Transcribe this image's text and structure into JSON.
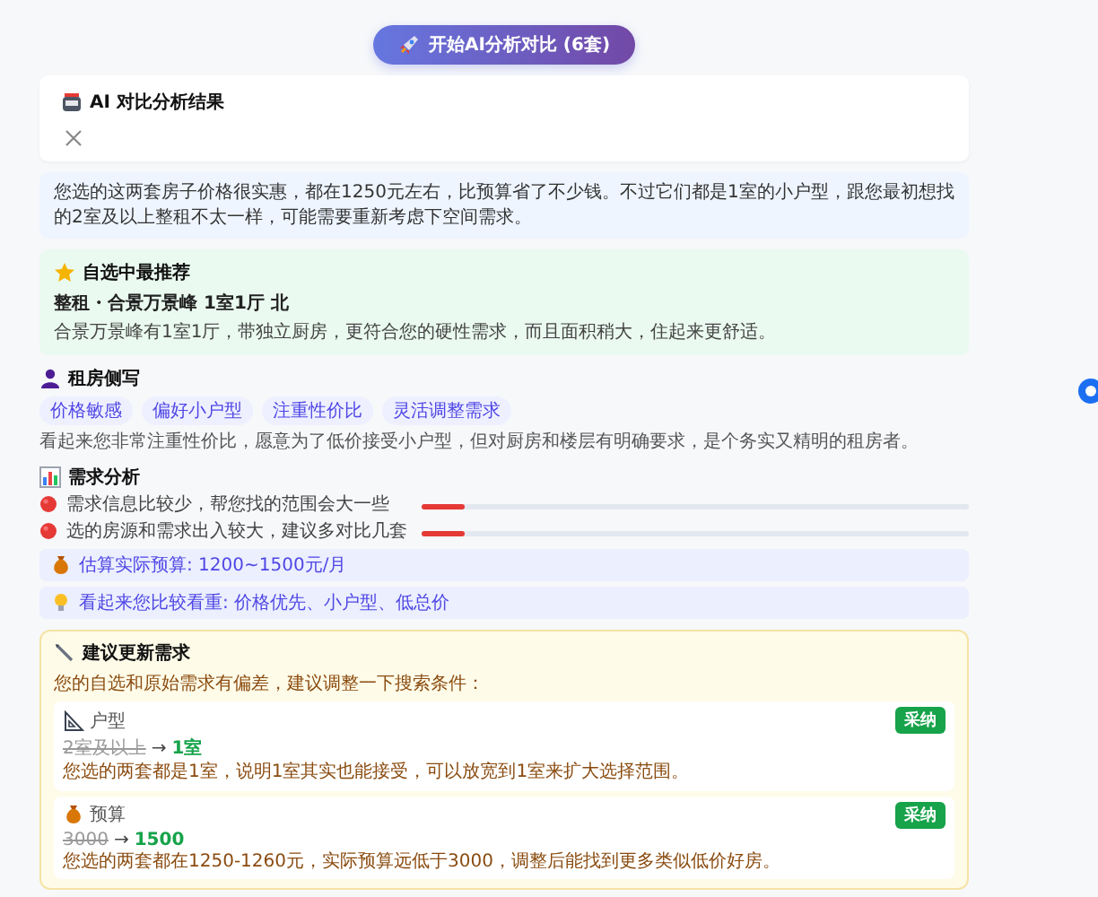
{
  "start_button": {
    "label": "开始AI分析对比 (6套)"
  },
  "result_card": {
    "title": "AI 对比分析结果"
  },
  "summary": "您选的这两套房子价格很实惠，都在1250元左右，比预算省了不少钱。不过它们都是1室的小户型，跟您最初想找的2室及以上整租不太一样，可能需要重新考虑下空间需求。",
  "recommendation": {
    "heading": "自选中最推荐",
    "title": "整租・合景万景峰 1室1厅 北",
    "description": "合景万景峰有1室1厅，带独立厨房，更符合您的硬性需求，而且面积稍大，住起来更舒适。"
  },
  "persona": {
    "heading": "租房侧写",
    "tags": [
      "价格敏感",
      "偏好小户型",
      "注重性价比",
      "灵活调整需求"
    ],
    "description": "看起来您非常注重性价比，愿意为了低价接受小户型，但对厨房和楼层有明确要求，是个务实又精明的租房者。"
  },
  "analysis": {
    "heading": "需求分析",
    "items": [
      {
        "text": "需求信息比较少，帮您找的范围会大一些",
        "level": 0.08
      },
      {
        "text": "选的房源和需求出入较大，建议多对比几套",
        "level": 0.08
      }
    ],
    "notes": [
      {
        "kind": "budget",
        "text": "估算实际预算: 1200~1500元/月"
      },
      {
        "kind": "tip",
        "text": "看起来您比较看重: 价格优先、小户型、低总价"
      }
    ]
  },
  "suggestions": {
    "heading": "建议更新需求",
    "intro": "您的自选和原始需求有偏差，建议调整一下搜索条件：",
    "items": [
      {
        "kind": "layout",
        "label": "户型",
        "old": "2室及以上",
        "arrow": "→",
        "new": "1室",
        "note": "您选的两套都是1室，说明1室其实也能接受，可以放宽到1室来扩大选择范围。",
        "button": "采纳"
      },
      {
        "kind": "budget",
        "label": "预算",
        "old": "3000",
        "arrow": "→",
        "new": "1500",
        "note": "您选的两套都在1250-1260元，实际预算远低于3000，调整后能找到更多类似低价好房。",
        "button": "采纳"
      }
    ]
  }
}
